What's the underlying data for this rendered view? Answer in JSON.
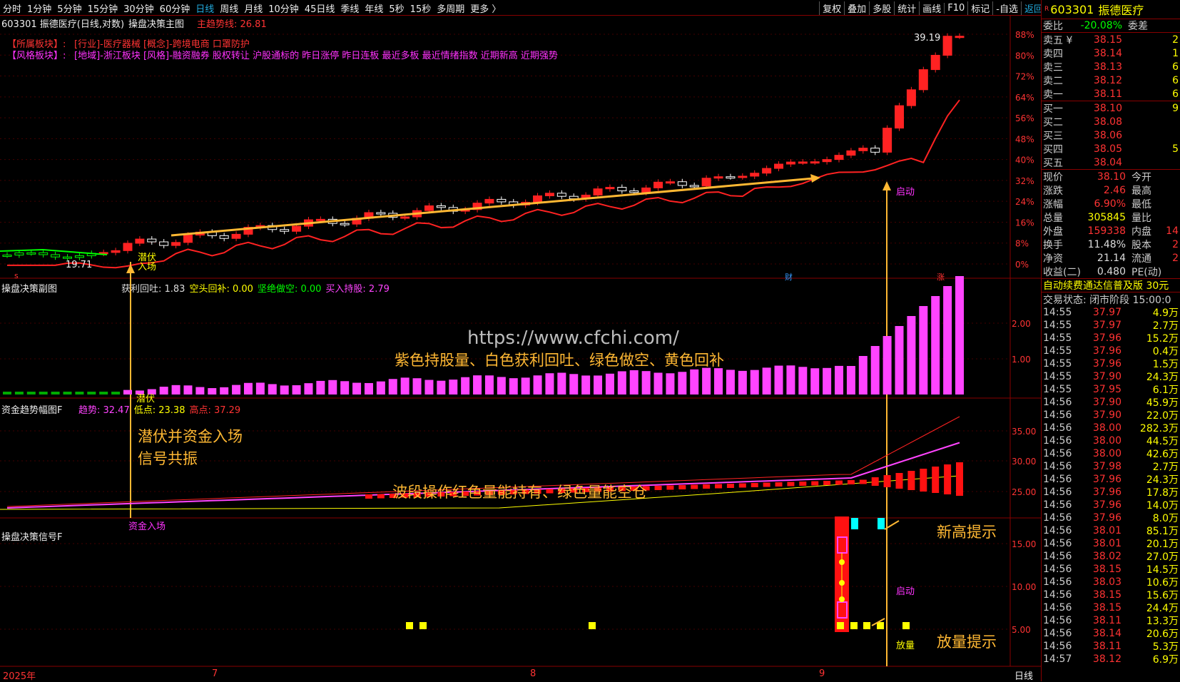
{
  "toolbar": {
    "periods": [
      "分时",
      "1分钟",
      "5分钟",
      "15分钟",
      "30分钟",
      "60分钟",
      "日线",
      "周线",
      "月线",
      "10分钟",
      "45日线",
      "季线",
      "年线",
      "5秒",
      "15秒",
      "多周期",
      "更多 〉"
    ],
    "active_period": "日线",
    "tools": [
      "复权",
      "叠加",
      "多股",
      "统计",
      "画线",
      "F10",
      "标记",
      "-自选"
    ],
    "return_label": "返回"
  },
  "main_panel": {
    "title_code": "603301 振德医疗(日线,对数)",
    "indicator_name": "操盘决策主图",
    "trend_line_label": "主趋势线: 26.81",
    "sector_line1_label": "【所属板块】:",
    "sector_line1_text": "[行业]-医疗器械 [概念]-跨境电商 口罩防护",
    "sector_line2_label": "【风格板块】:",
    "sector_line2_text": "[地域]-浙江板块 [风格]-融资融券 股权转让 沪股通标的 昨日涨停 昨日连板 最近多板 最近情绪指数 近期新高 近期强势",
    "high_label": "39.19",
    "low_label": "19.71",
    "qifu_label": "潜伏",
    "ruchang_label": "入场",
    "qidong_label": "启动",
    "cai_label": "财",
    "zhang_label": "涨",
    "s_label": "s",
    "pct_axis": [
      "88%",
      "80%",
      "72%",
      "64%",
      "56%",
      "48%",
      "40%",
      "32%",
      "24%",
      "16%",
      "8%",
      "0%"
    ]
  },
  "sub1": {
    "title": "操盘决策副图",
    "items": [
      {
        "label": "获利回吐: 1.83",
        "color": "#dddddd"
      },
      {
        "label": "空头回补: 0.00",
        "color": "#ffff00"
      },
      {
        "label": "坚绝做空: 0.00",
        "color": "#00ff00"
      },
      {
        "label": "买入持股: 2.79",
        "color": "#ff44ff"
      }
    ],
    "axis": [
      "2.00",
      "1.00"
    ],
    "annotation": "紫色持股量、白色获利回吐、绿色做空、黄色回补",
    "watermark": "https://www.cfchi.com/",
    "qifu_label": "潜伏"
  },
  "sub2": {
    "title": "资金趋势幅图F",
    "items": [
      {
        "label": "趋势: 32.47",
        "color": "#ff44ff"
      },
      {
        "label": "低点: 23.38",
        "color": "#ffff00"
      },
      {
        "label": "高点: 37.29",
        "color": "#ff3333"
      }
    ],
    "axis": [
      "35.00",
      "30.00",
      "25.00"
    ],
    "annotation": "波段操作红色量能持有、绿色量能空仓",
    "annotation_left_1": "潜伏并资金入场",
    "annotation_left_2": "信号共振",
    "zijin_label": "资金入场"
  },
  "sub3": {
    "title": "操盘决策信号F",
    "axis": [
      "15.00",
      "10.00",
      "5.00"
    ],
    "qidong_label": "启动",
    "fangliang_label": "放量",
    "annotation_high": "新高提示",
    "annotation_vol": "放量提示"
  },
  "xaxis": {
    "labels": [
      "2025年",
      "7",
      "8",
      "9"
    ],
    "period_label": "日线"
  },
  "right": {
    "code": "603301",
    "name": "振德医疗",
    "weibi_label": "委比",
    "weibi_value": "-20.08%",
    "weicha_label": "委差",
    "asks": [
      {
        "label": "卖五 ¥",
        "price": "38.15",
        "vol": "2"
      },
      {
        "label": "卖四",
        "price": "38.14",
        "vol": "1"
      },
      {
        "label": "卖三",
        "price": "38.13",
        "vol": "6"
      },
      {
        "label": "卖二",
        "price": "38.12",
        "vol": "6"
      },
      {
        "label": "卖一",
        "price": "38.11",
        "vol": "6"
      }
    ],
    "bids": [
      {
        "label": "买一",
        "price": "38.10",
        "vol": "9"
      },
      {
        "label": "买二",
        "price": "38.08",
        "vol": ""
      },
      {
        "label": "买三",
        "price": "38.06",
        "vol": ""
      },
      {
        "label": "买四",
        "price": "38.05",
        "vol": "5"
      },
      {
        "label": "买五",
        "price": "38.04",
        "vol": ""
      }
    ],
    "quote": [
      {
        "k": "现价",
        "v": "38.10",
        "vc": "#ff3333",
        "k2": "今开",
        "v2": ""
      },
      {
        "k": "涨跌",
        "v": "2.46",
        "vc": "#ff3333",
        "k2": "最高",
        "v2": ""
      },
      {
        "k": "涨幅",
        "v": "6.90%",
        "vc": "#ff3333",
        "k2": "最低",
        "v2": ""
      },
      {
        "k": "总量",
        "v": "305845",
        "vc": "#ffff00",
        "k2": "量比",
        "v2": ""
      },
      {
        "k": "外盘",
        "v": "159338",
        "vc": "#ff3333",
        "k2": "内盘",
        "v2": "14"
      },
      {
        "k": "换手",
        "v": "11.48%",
        "vc": "#dddddd",
        "k2": "股本",
        "v2": "2"
      },
      {
        "k": "净资",
        "v": "21.14",
        "vc": "#dddddd",
        "k2": "流通",
        "v2": "2"
      },
      {
        "k": "收益(二)",
        "v": "0.480",
        "vc": "#dddddd",
        "k2": "PE(动)",
        "v2": ""
      }
    ],
    "news": "自动续费通达信普及版  30元",
    "trade_status": "交易状态: 闭市阶段 15:00:0",
    "ticks": [
      {
        "t": "14:55",
        "p": "37.97",
        "v": "4.9万"
      },
      {
        "t": "14:55",
        "p": "37.97",
        "v": "2.7万"
      },
      {
        "t": "14:55",
        "p": "37.96",
        "v": "15.2万"
      },
      {
        "t": "14:55",
        "p": "37.96",
        "v": "0.4万"
      },
      {
        "t": "14:55",
        "p": "37.96",
        "v": "1.5万"
      },
      {
        "t": "14:55",
        "p": "37.90",
        "v": "24.3万"
      },
      {
        "t": "14:55",
        "p": "37.95",
        "v": "6.1万"
      },
      {
        "t": "14:56",
        "p": "37.90",
        "v": "45.9万"
      },
      {
        "t": "14:56",
        "p": "37.90",
        "v": "22.0万"
      },
      {
        "t": "14:56",
        "p": "38.00",
        "v": "282.3万"
      },
      {
        "t": "14:56",
        "p": "38.00",
        "v": "44.5万"
      },
      {
        "t": "14:56",
        "p": "38.00",
        "v": "42.6万"
      },
      {
        "t": "14:56",
        "p": "37.98",
        "v": "2.7万"
      },
      {
        "t": "14:56",
        "p": "37.96",
        "v": "24.3万"
      },
      {
        "t": "14:56",
        "p": "37.96",
        "v": "17.8万"
      },
      {
        "t": "14:56",
        "p": "37.96",
        "v": "14.0万"
      },
      {
        "t": "14:56",
        "p": "37.96",
        "v": "8.0万"
      },
      {
        "t": "14:56",
        "p": "38.01",
        "v": "85.1万"
      },
      {
        "t": "14:56",
        "p": "38.01",
        "v": "20.1万"
      },
      {
        "t": "14:56",
        "p": "38.02",
        "v": "27.0万"
      },
      {
        "t": "14:56",
        "p": "38.15",
        "v": "14.5万"
      },
      {
        "t": "14:56",
        "p": "38.03",
        "v": "10.6万"
      },
      {
        "t": "14:56",
        "p": "38.15",
        "v": "15.6万"
      },
      {
        "t": "14:56",
        "p": "38.15",
        "v": "24.4万"
      },
      {
        "t": "14:56",
        "p": "38.11",
        "v": "13.3万"
      },
      {
        "t": "14:56",
        "p": "38.14",
        "v": "20.6万"
      },
      {
        "t": "14:56",
        "p": "38.11",
        "v": "5.3万"
      },
      {
        "t": "14:57",
        "p": "38.12",
        "v": "6.9万"
      }
    ]
  }
}
